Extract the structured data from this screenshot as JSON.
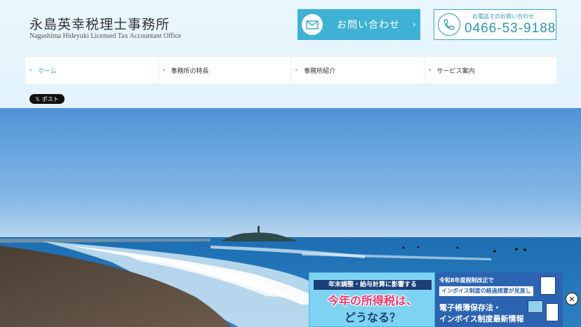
{
  "header": {
    "office_name_jp": "永島英幸税理士事務所",
    "office_name_en": "Nagashima Hideyuki Licensed Tax Accountant Office",
    "contact_button": {
      "label": "お問い合わせ",
      "chevron": "›",
      "icon": "mail-icon"
    },
    "phone": {
      "caption": "お電話でのお問い合わせ",
      "number": "0466-53-9188",
      "icon": "phone-icon"
    }
  },
  "nav": {
    "items": [
      {
        "label": "ホーム",
        "active": true
      },
      {
        "label": "事務所の特長",
        "active": false
      },
      {
        "label": "事務所紹介",
        "active": false
      },
      {
        "label": "サービス案内",
        "active": false
      }
    ]
  },
  "social": {
    "x_post_label": "ポスト",
    "x_glyph": "𝕏"
  },
  "hero": {
    "image": "beach-photo"
  },
  "ad_banner": {
    "left": {
      "line1": "年末調整・給与計算に影響する",
      "line2": "今年の所得税は、",
      "line3": "どうなる？"
    },
    "right": {
      "line1": "令和8年度税制改正で",
      "line2": "インボイス制度の経過措置が見直し",
      "line3": "電子帳簿保存法・",
      "line4": "インボイス制度最新情報"
    },
    "close_glyph": "✕"
  },
  "colors": {
    "accent": "#3eb1d5",
    "phone": "#2f93b6",
    "header_bg": "#e9f6fd",
    "banner_pink": "#e8386b",
    "banner_navy": "#1c3f78",
    "banner_blue": "#2c64b2"
  }
}
